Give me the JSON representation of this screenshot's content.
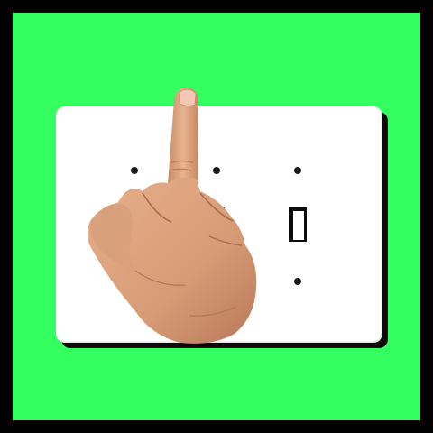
{
  "image": {
    "description_colors": {
      "frame": "#000000",
      "background": "#33ff5f",
      "plate": "#ffffff",
      "skin": "#d9a07a"
    },
    "icons": [
      "light-switch-plate",
      "hand-gesture-icon"
    ]
  }
}
